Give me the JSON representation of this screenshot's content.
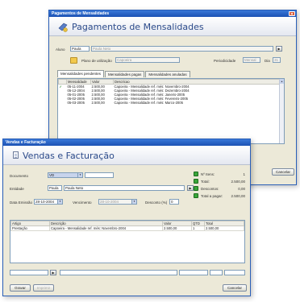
{
  "back_window": {
    "title": "Pagamentos de Mensalidades",
    "header": "Pagamentos de Mensalidades",
    "aluno_label": "Aluno",
    "aluno_code": "Paula",
    "aluno_name": "Paula Neto",
    "plano_label": "Plano de utilização",
    "plano_value": "Capoeira",
    "periodicidade_label": "Periodicidade",
    "periodicidade_value": "Mensal",
    "dia_label": "Dia",
    "dia_value": "31",
    "tabs": [
      "Mensalidades pendentes",
      "Mensalidades pagas",
      "Mensalidades anuladas"
    ],
    "columns": [
      "Mensalidade",
      "Valor",
      "Descricao"
    ],
    "rows": [
      {
        "check": "✓",
        "date": "05-11-2004",
        "valor": "2.500,00",
        "desc": "Capoeira - Mensalidade ref. més: Novembro-2004"
      },
      {
        "check": "",
        "date": "05-12-2004",
        "valor": "2.500,00",
        "desc": "Capoeira - Mensalidade ref. més: Dezembro-2004"
      },
      {
        "check": "",
        "date": "05-01-2005",
        "valor": "2.500,00",
        "desc": "Capoeira - Mensalidade ref. més: Janeiro-2005"
      },
      {
        "check": "",
        "date": "05-02-2005",
        "valor": "2.500,00",
        "desc": "Capoeira - Mensalidade ref. més: Fevereiro-2005"
      },
      {
        "check": "",
        "date": "05-03-2005",
        "valor": "2.500,00",
        "desc": "Capoeira - Mensalidade ref. més: Marco-2005"
      }
    ],
    "cancel_label": "Cancelar"
  },
  "front_window": {
    "title": "Vendas e Facturação",
    "header": "Vendas e Facturação",
    "documento_label": "Documento",
    "documento_type": "VD",
    "entidade_label": "Entidade",
    "entidade_code": "Paula",
    "entidade_name": "Paula Neto",
    "data_emissao_label": "Data Emissão",
    "data_emissao_value": "28-10-2004",
    "vencimento_label": "Vencimento",
    "vencimento_value": "28-10-2004",
    "desconto_label": "Desconto (%)",
    "desconto_value": "0",
    "totals": [
      {
        "label": "Nº Itens:",
        "value": "1"
      },
      {
        "label": "Total:",
        "value": "2.500,00"
      },
      {
        "label": "Descontos:",
        "value": "0,00"
      },
      {
        "label": "Total a pagar:",
        "value": "2.500,00"
      }
    ],
    "columns": [
      "Artigo",
      "Descrição",
      "Valor",
      "QTD",
      "Total"
    ],
    "rows": [
      {
        "artigo": "Prestação",
        "descricao": "Capoeira - Mensalidade ref. més: Novembro-2004",
        "valor": "2.500,00",
        "qtd": "1",
        "total": "2.500,00"
      }
    ],
    "gravar_label": "Gravar",
    "imprimir_label": "Imprimir",
    "cancel_label": "Cancelar"
  }
}
